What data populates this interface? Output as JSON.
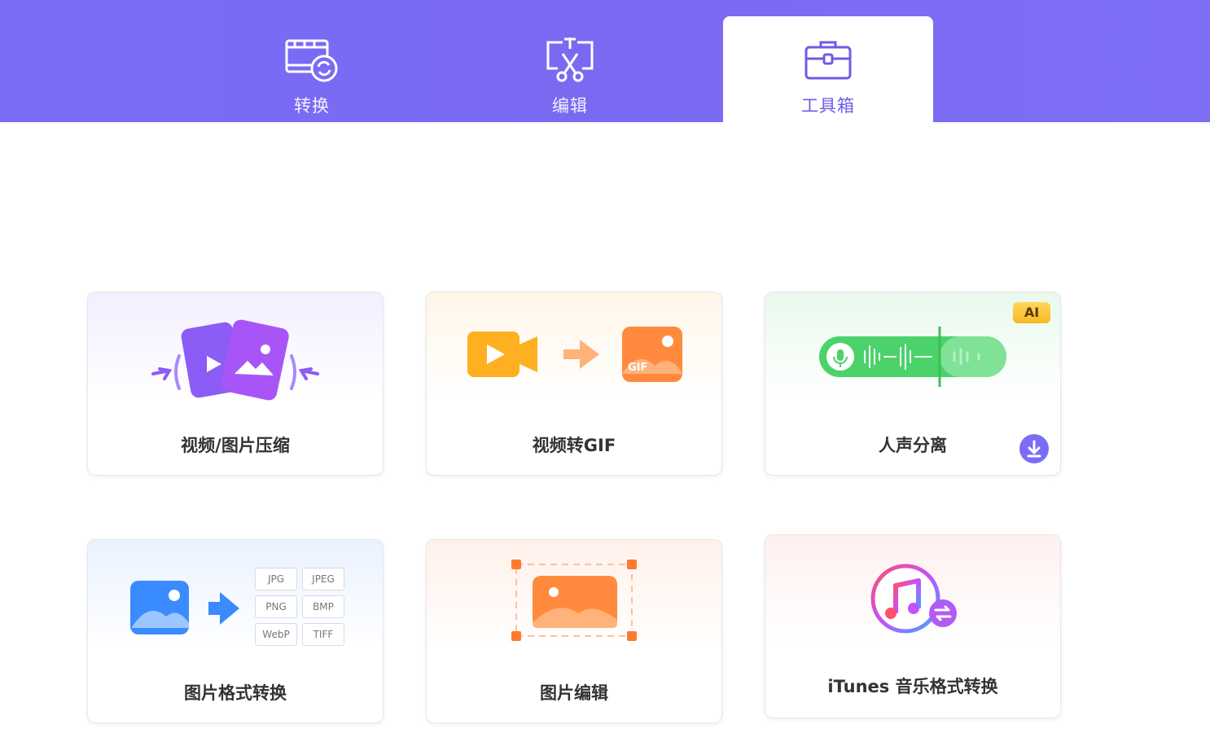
{
  "tabs": [
    {
      "label": "转换",
      "icon": "film-convert-icon",
      "active": false
    },
    {
      "label": "编辑",
      "icon": "scissors-crop-icon",
      "active": false
    },
    {
      "label": "工具箱",
      "icon": "toolbox-icon",
      "active": true
    }
  ],
  "tools": [
    {
      "label": "视频/图片压缩",
      "icon": "compress-media-icon"
    },
    {
      "label": "视频转GIF",
      "icon": "video-to-gif-icon",
      "art_text": "GIF"
    },
    {
      "label": "人声分离",
      "icon": "voice-separation-icon",
      "badge": "AI",
      "download": true
    },
    {
      "label": "图片格式转换",
      "icon": "image-format-icon",
      "formats": [
        "JPG",
        "JPEG",
        "PNG",
        "BMP",
        "WebP",
        "TIFF"
      ]
    },
    {
      "label": "图片编辑",
      "icon": "image-edit-icon"
    },
    {
      "label": "iTunes 音乐格式转换",
      "icon": "itunes-convert-icon"
    }
  ],
  "colors": {
    "accent": "#7b6cf6",
    "orange": "#ff8a3d",
    "green": "#4cd26b",
    "blue": "#3a8bff"
  }
}
